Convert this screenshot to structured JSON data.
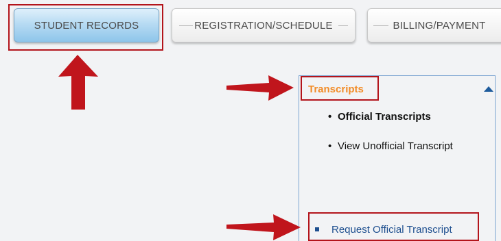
{
  "tabs": [
    {
      "label": "STUDENT RECORDS"
    },
    {
      "label": "REGISTRATION/SCHEDULE"
    },
    {
      "label": "BILLING/PAYMENT"
    }
  ],
  "panel": {
    "title": "Transcripts",
    "items": [
      {
        "label": "Official Transcripts"
      },
      {
        "label": "View Unofficial Transcript"
      }
    ]
  },
  "request_link": {
    "label": "Request Official Transcript"
  },
  "colors": {
    "highlight": "#b3141b",
    "arrow": "#c0151c",
    "panel_title": "#f28c28",
    "link": "#1e4f8f",
    "active_tab": "#8ec5ea"
  }
}
